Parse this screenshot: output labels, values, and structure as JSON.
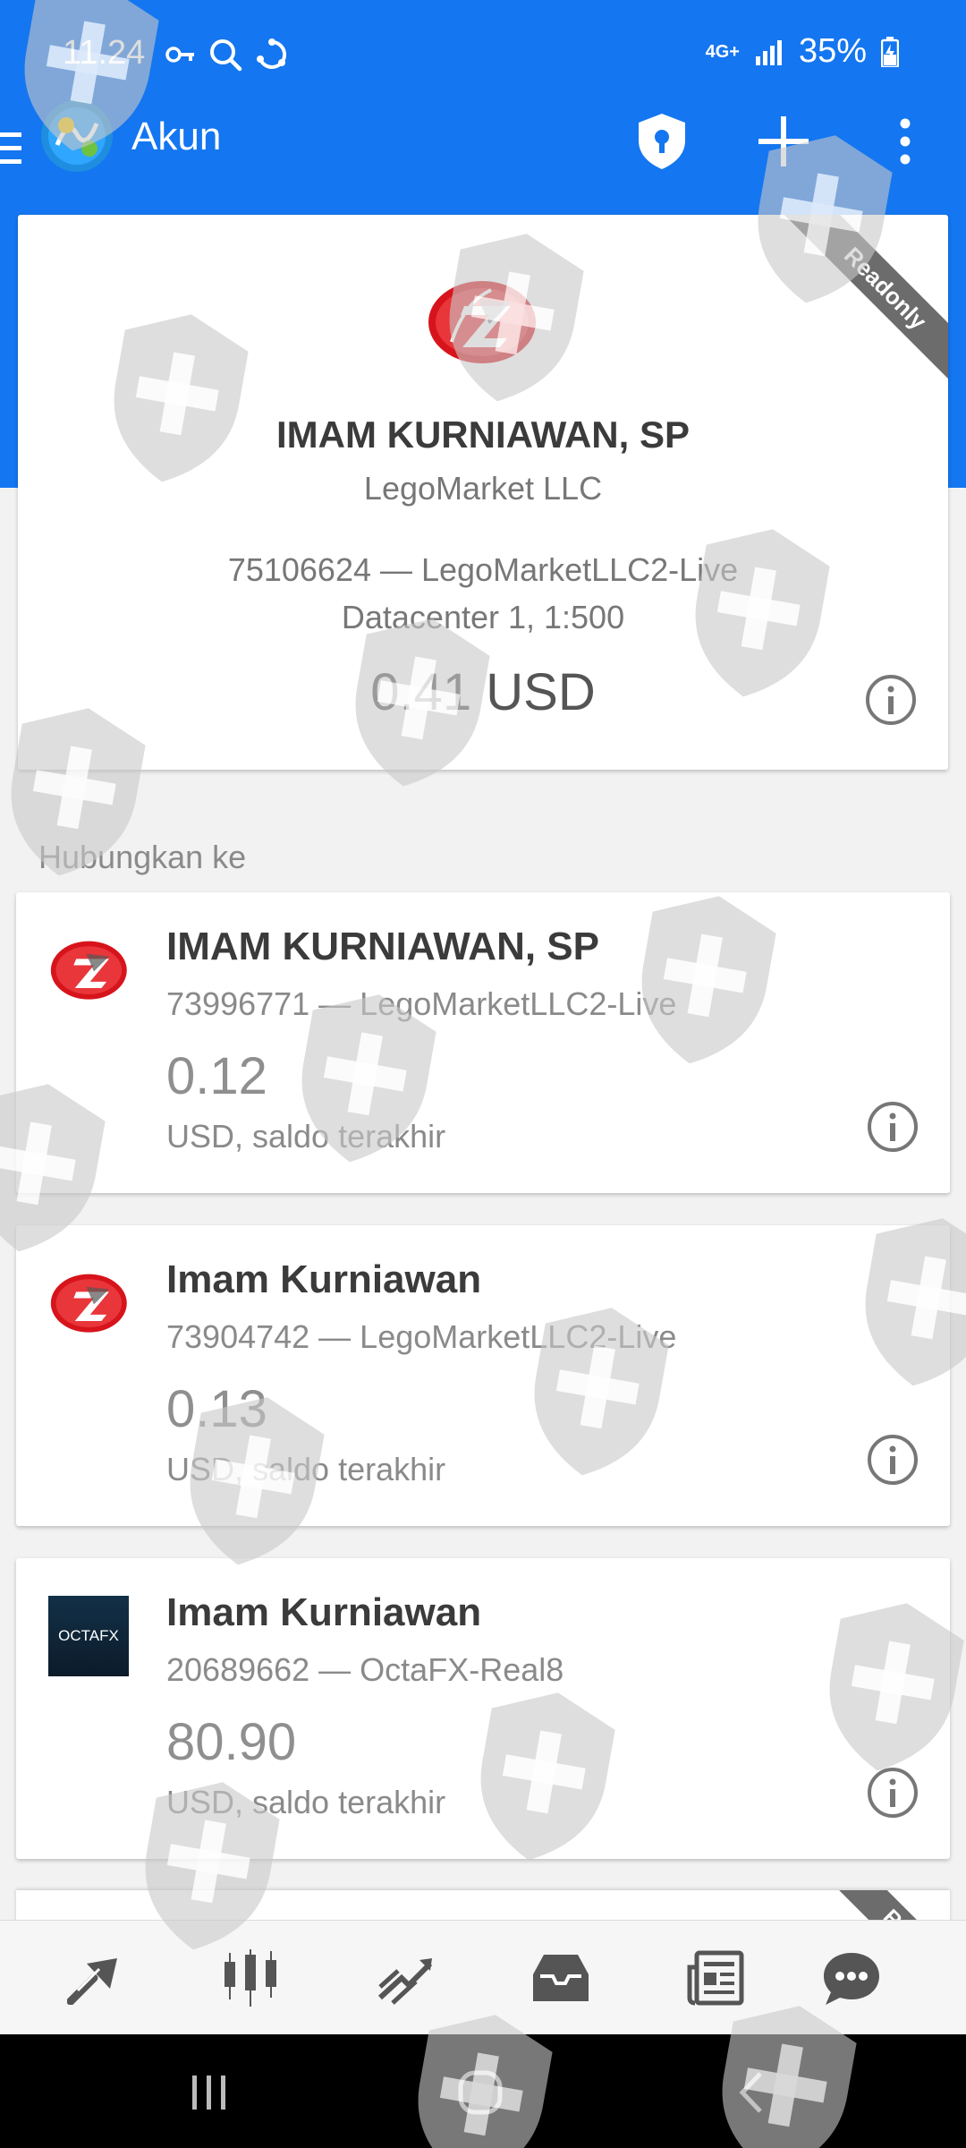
{
  "status_bar": {
    "time": "11.24",
    "network": "4G+",
    "battery": "35%"
  },
  "app_bar": {
    "title": "Akun",
    "icons": [
      "menu-icon",
      "metatrader-logo",
      "shield-lock-icon",
      "add-icon",
      "more-vert-icon"
    ]
  },
  "current_account": {
    "readonly_label": "Readonly",
    "name": "IMAM KURNIAWAN, SP",
    "company": "LegoMarket LLC",
    "account_line": "75106624 — LegoMarketLLC2-Live",
    "server_line": "Datacenter 1, 1:500",
    "balance": "0.41 USD"
  },
  "section_label": "Hubungkan ke",
  "accounts": [
    {
      "name": "IMAM KURNIAWAN, SP",
      "number": "73996771 — LegoMarketLLC2-Live",
      "balance": "0.12",
      "subtitle": "USD, saldo terakhir",
      "logo": "legomarket-logo"
    },
    {
      "name": "Imam Kurniawan",
      "number": "73904742 — LegoMarketLLC2-Live",
      "balance": "0.13",
      "subtitle": "USD, saldo terakhir",
      "logo": "legomarket-logo"
    },
    {
      "name": "Imam Kurniawan",
      "number": "20689662 — OctaFX-Real8",
      "balance": "80.90",
      "subtitle": "USD, saldo terakhir",
      "logo": "octafx-logo",
      "logo_text": "OCTAFX"
    }
  ],
  "partial_ribbon": "Re",
  "toolbar": [
    "quotes-icon",
    "chart-icon",
    "trade-icon",
    "history-icon",
    "news-icon",
    "chat-icon"
  ],
  "colors": {
    "primary": "#1476f0",
    "brand_red": "#d7141b"
  }
}
